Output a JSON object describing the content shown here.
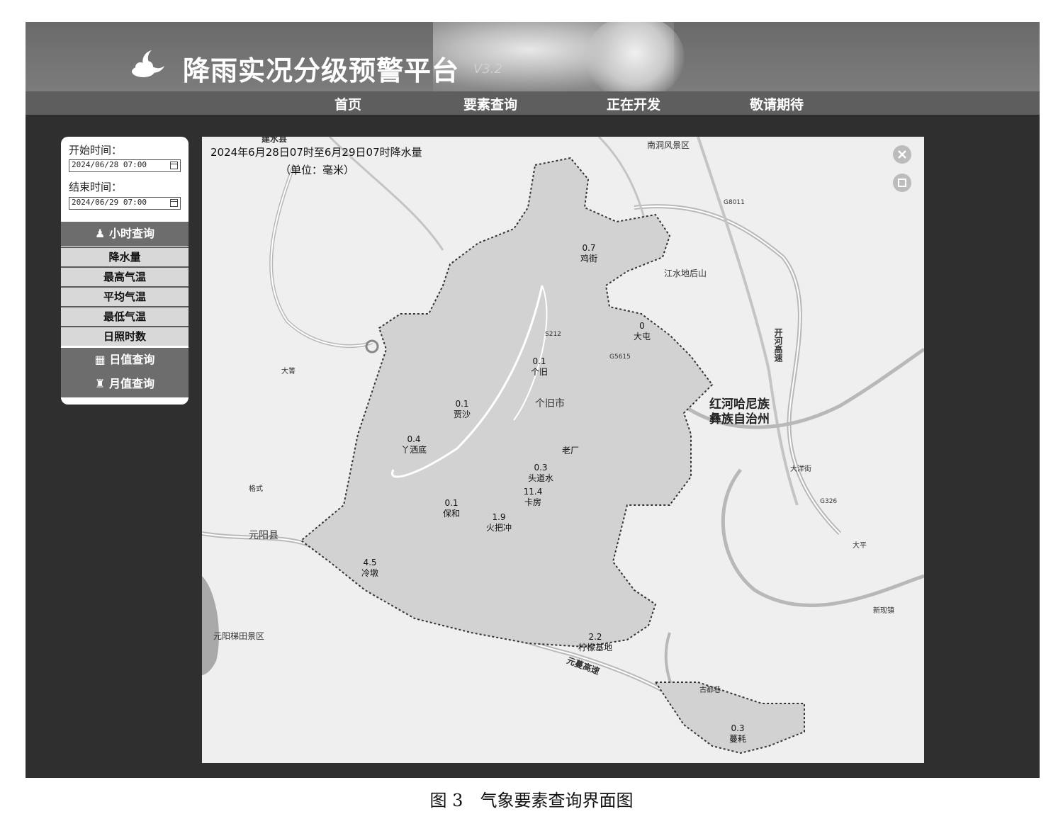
{
  "app": {
    "title": "降雨实况分级预警平台",
    "version": "V3.2"
  },
  "nav": [
    "首页",
    "要素查询",
    "正在开发",
    "敬请期待"
  ],
  "sidebar": {
    "start_label": "开始时间：",
    "start_value": "2024/06/28 07:00",
    "end_label": "结束时间：",
    "end_value": "2024/06/29 07:00",
    "hourly_query": "小时查询",
    "items": [
      "降水量",
      "最高气温",
      "平均气温",
      "最低气温",
      "日照时数"
    ],
    "daily_query": "日值查询",
    "monthly_query": "月值查询"
  },
  "map": {
    "title": "2024年6月28日07时至6月29日07时降水量",
    "unit": "（单位：毫米）",
    "stations": [
      {
        "value": "0.7",
        "name": "鸡街"
      },
      {
        "value": "0",
        "name": "大屯"
      },
      {
        "value": "0.1",
        "name": "个旧"
      },
      {
        "value": "0.1",
        "name": "贾沙"
      },
      {
        "value": "0.4",
        "name": "丫洒底"
      },
      {
        "value": "0.3",
        "name": "头道水"
      },
      {
        "value": "11.4",
        "name": "卡房"
      },
      {
        "value": "0.1",
        "name": "保和"
      },
      {
        "value": "1.9",
        "name": "火把冲"
      },
      {
        "value": "4.5",
        "name": "冷墩"
      },
      {
        "value": "2.2",
        "name": "柠檬基地"
      },
      {
        "value": "0.3",
        "name": "蔓耗"
      }
    ],
    "places": {
      "gejiu_city": "个旧市",
      "laochang": "老厂",
      "jiangshui": "江水地后山",
      "nandong": "南洞风景区",
      "yuanyang": "元阳县",
      "yuanyang_terrace": "元阳梯田景区",
      "honghe_line1": "红河哈尼族",
      "honghe_line2": "彝族自治州",
      "yuanman": "元蔓高速",
      "kaihe": "开河高速",
      "jianshui": "建水县",
      "daping": "大箐",
      "gejie": "格式",
      "dayangjie": "大洋街",
      "daping2": "大平",
      "xinxian": "新现镇",
      "gudaju": "古都巷",
      "g8011": "G8011",
      "g326": "G326",
      "g5615": "G5615",
      "s212": "S212"
    }
  },
  "caption": "图 3　气象要素查询界面图"
}
